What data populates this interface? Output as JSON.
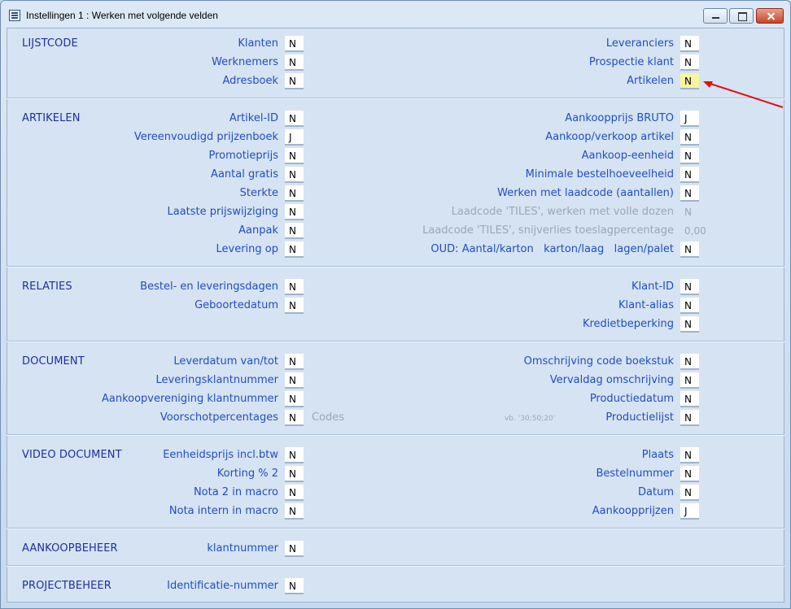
{
  "window": {
    "title": "Instellingen 1 :  Werken met volgende velden"
  },
  "sections": {
    "lijstcode": "LIJSTCODE",
    "artikelen": "ARTIKELEN",
    "relaties": "RELATIES",
    "document": "DOCUMENT",
    "video_document": "VIDEO DOCUMENT",
    "aankoopbeheer": "AANKOOPBEHEER",
    "projectbeheer": "PROJECTBEHEER"
  },
  "lijstcode": {
    "klanten": {
      "label": "Klanten",
      "value": "N"
    },
    "werknemers": {
      "label": "Werknemers",
      "value": "N"
    },
    "adresboek": {
      "label": "Adresboek",
      "value": "N"
    },
    "leveranciers": {
      "label": "Leveranciers",
      "value": "N"
    },
    "prospectie": {
      "label": "Prospectie klant",
      "value": "N"
    },
    "artikelen": {
      "label": "Artikelen",
      "value": "N"
    }
  },
  "artikelen": {
    "artikel_id": {
      "label": "Artikel-ID",
      "value": "N"
    },
    "vereenvoudigd": {
      "label": "Vereenvoudigd prijzenboek",
      "value": "J"
    },
    "promotieprijs": {
      "label": "Promotieprijs",
      "value": "N"
    },
    "aantal_gratis": {
      "label": "Aantal gratis",
      "value": "N"
    },
    "sterkte": {
      "label": "Sterkte",
      "value": "N"
    },
    "laatste_prijs": {
      "label": "Laatste prijswijziging",
      "value": "N"
    },
    "aanpak": {
      "label": "Aanpak",
      "value": "N"
    },
    "levering_op": {
      "label": "Levering op",
      "value": "N"
    },
    "aankoopprijs_bruto": {
      "label": "Aankoopprijs BRUTO",
      "value": "J"
    },
    "aankoop_verkoop": {
      "label": "Aankoop/verkoop artikel",
      "value": "N"
    },
    "aankoop_eenheid": {
      "label": "Aankoop-eenheid",
      "value": "N"
    },
    "min_bestel": {
      "label": "Minimale bestelhoeveelheid",
      "value": "N"
    },
    "laadcode": {
      "label": "Werken met laadcode (aantallen)",
      "value": "N"
    },
    "tiles_dozen": {
      "label": "Laadcode 'TILES', werken met volle dozen",
      "value": "N"
    },
    "tiles_snij": {
      "label": "Laadcode 'TILES', snijverlies toeslagpercentage",
      "value": "0,00"
    },
    "oud_label": "OUD: Aantal/karton   karton/laag   lagen/palet",
    "oud_value": "N"
  },
  "relaties": {
    "bestel_dagen": {
      "label": "Bestel- en leveringsdagen",
      "value": "N"
    },
    "geboortedatum": {
      "label": "Geboortedatum",
      "value": "N"
    },
    "klant_id": {
      "label": "Klant-ID",
      "value": "N"
    },
    "klant_alias": {
      "label": "Klant-alias",
      "value": "N"
    },
    "krediet": {
      "label": "Kredietbeperking",
      "value": "N"
    }
  },
  "document": {
    "leverdatum": {
      "label": "Leverdatum van/tot",
      "value": "N"
    },
    "leveringsklantnr": {
      "label": "Leveringsklantnummer",
      "value": "N"
    },
    "aankoopver": {
      "label": "Aankoopvereniging klantnummer",
      "value": "N"
    },
    "voorschot": {
      "label": "Voorschotpercentages",
      "value": "N"
    },
    "codes_placeholder": "Codes",
    "example_hint": "vb. '30;50;20'",
    "omschrijving_code": {
      "label": "Omschrijving code boekstuk",
      "value": "N"
    },
    "vervaldag": {
      "label": "Vervaldag omschrijving",
      "value": "N"
    },
    "productiedatum": {
      "label": "Productiedatum",
      "value": "N"
    },
    "productielijst": {
      "label": "Productielijst",
      "value": "N"
    }
  },
  "video_document": {
    "eenheidsprijs": {
      "label": "Eenheidsprijs incl.btw",
      "value": "N"
    },
    "korting": {
      "label": "Korting % 2",
      "value": "N"
    },
    "nota2": {
      "label": "Nota 2 in macro",
      "value": "N"
    },
    "nota_intern": {
      "label": "Nota intern in macro",
      "value": "N"
    },
    "plaats": {
      "label": "Plaats",
      "value": "N"
    },
    "bestelnummer": {
      "label": "Bestelnummer",
      "value": "N"
    },
    "datum": {
      "label": "Datum",
      "value": "N"
    },
    "aankoopprijzen": {
      "label": "Aankoopprijzen",
      "value": "J"
    }
  },
  "aankoopbeheer": {
    "klantnummer": {
      "label": "klantnummer",
      "value": "N"
    }
  },
  "projectbeheer": {
    "identificatie": {
      "label": "Identificatie-nummer",
      "value": "N"
    }
  },
  "colors": {
    "label": "#1f4fbf",
    "section": "#1f2f9e",
    "highlight": "#f6f4a0",
    "arrow": "#e01010"
  }
}
